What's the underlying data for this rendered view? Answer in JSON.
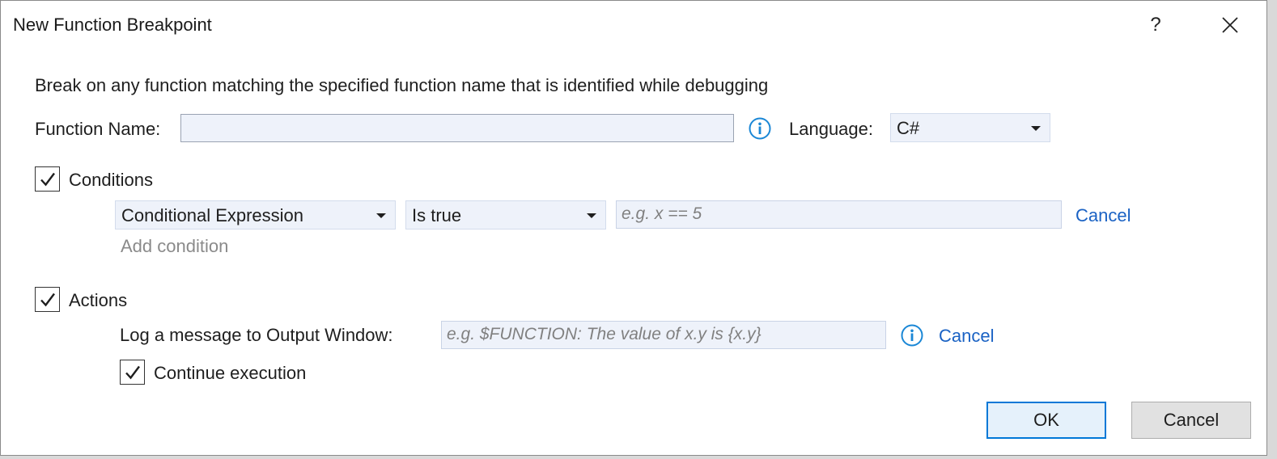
{
  "window": {
    "title": "New Function Breakpoint",
    "help_label": "?"
  },
  "description": "Break on any function matching the specified function name that is identified while debugging",
  "function_name": {
    "label": "Function Name:",
    "value": "",
    "info_icon": "info-circle-icon"
  },
  "language": {
    "label": "Language:",
    "selected": "C#"
  },
  "conditions": {
    "label": "Conditions",
    "checked": true,
    "expression_type": "Conditional Expression",
    "condition": "Is true",
    "expression_placeholder": "e.g. x == 5",
    "cancel_label": "Cancel",
    "add_condition_label": "Add condition"
  },
  "actions": {
    "label": "Actions",
    "checked": true,
    "log_label": "Log a message to Output Window:",
    "log_placeholder": "e.g. $FUNCTION: The value of x.y is {x.y}",
    "cancel_label": "Cancel",
    "continue_label": "Continue execution",
    "continue_checked": true
  },
  "footer": {
    "ok_label": "OK",
    "cancel_label": "Cancel"
  },
  "colors": {
    "accent": "#0078d7",
    "link": "#1a62c4",
    "info_icon": "#1a87d6",
    "field_background": "#eef2fa"
  }
}
